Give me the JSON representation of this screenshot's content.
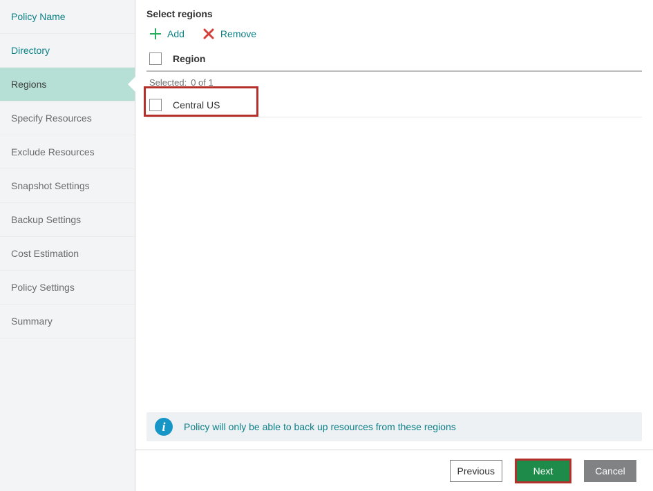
{
  "sidebar": {
    "items": [
      {
        "label": "Policy Name",
        "state": "link"
      },
      {
        "label": "Directory",
        "state": "link"
      },
      {
        "label": "Regions",
        "state": "active"
      },
      {
        "label": "Specify Resources",
        "state": "disabled"
      },
      {
        "label": "Exclude Resources",
        "state": "disabled"
      },
      {
        "label": "Snapshot Settings",
        "state": "disabled"
      },
      {
        "label": "Backup Settings",
        "state": "disabled"
      },
      {
        "label": "Cost Estimation",
        "state": "disabled"
      },
      {
        "label": "Policy Settings",
        "state": "disabled"
      },
      {
        "label": "Summary",
        "state": "disabled"
      }
    ]
  },
  "header": {
    "title": "Select regions"
  },
  "toolbar": {
    "add_label": "Add",
    "remove_label": "Remove"
  },
  "table": {
    "column_header": "Region",
    "selected_prefix": "Selected:",
    "selected_value": "0 of 1",
    "rows": [
      {
        "name": "Central US"
      }
    ]
  },
  "info": {
    "text": "Policy will only be able to back up resources from these regions"
  },
  "footer": {
    "previous": "Previous",
    "next": "Next",
    "cancel": "Cancel"
  }
}
